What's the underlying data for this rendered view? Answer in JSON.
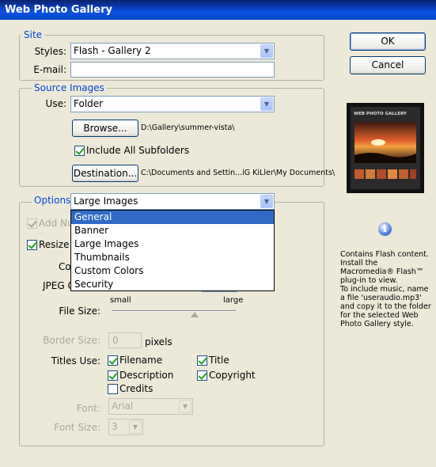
{
  "window": {
    "title": "Web Photo Gallery"
  },
  "site": {
    "legend": "Site",
    "styles_label": "Styles:",
    "styles_value": "Flash - Gallery 2",
    "email_label": "E-mail:",
    "email_value": ""
  },
  "source": {
    "legend": "Source Images",
    "use_label": "Use:",
    "use_value": "Folder",
    "browse_label": "Browse...",
    "browse_path": "D:\\Gallery\\summer-vista\\",
    "include_subfolders_label": "Include All Subfolders",
    "include_subfolders_checked": true,
    "destination_label": "Destination...",
    "destination_path": "C:\\Documents and Settin...iG KiLler\\My Documents\\"
  },
  "options": {
    "legend": "Options:",
    "selected": "Large Images",
    "dropdown_items": [
      "General",
      "Banner",
      "Large Images",
      "Thumbnails",
      "Custom Colors",
      "Security"
    ],
    "dropdown_highlighted": "General",
    "add_numeric_label": "Add Nu",
    "resize_label": "Resize I",
    "constrain_label": "Co",
    "jpeg_label": "JPEG Q",
    "slider_small": "small",
    "slider_large": "large",
    "file_size_label": "File Size:",
    "border_size_label": "Border Size:",
    "border_size_value": "0",
    "border_size_unit": "pixels",
    "titles_use_label": "Titles Use:",
    "titles": [
      {
        "label": "Filename",
        "checked": true
      },
      {
        "label": "Title",
        "checked": true
      },
      {
        "label": "Description",
        "checked": true
      },
      {
        "label": "Copyright",
        "checked": true
      },
      {
        "label": "Credits",
        "checked": false
      }
    ],
    "font_label": "Font:",
    "font_value": "Arial",
    "font_size_label": "Font Size:",
    "font_size_value": "3"
  },
  "buttons": {
    "ok": "OK",
    "cancel": "Cancel"
  },
  "preview": {
    "title": "WEB PHOTO GALLERY"
  },
  "info": {
    "text1": "Contains Flash content. Install the Macromedia® Flash™ plug-in to view.",
    "text2": "To include music, name a file 'useraudio.mp3' and copy it to the folder for the selected Web Photo Gallery style."
  }
}
